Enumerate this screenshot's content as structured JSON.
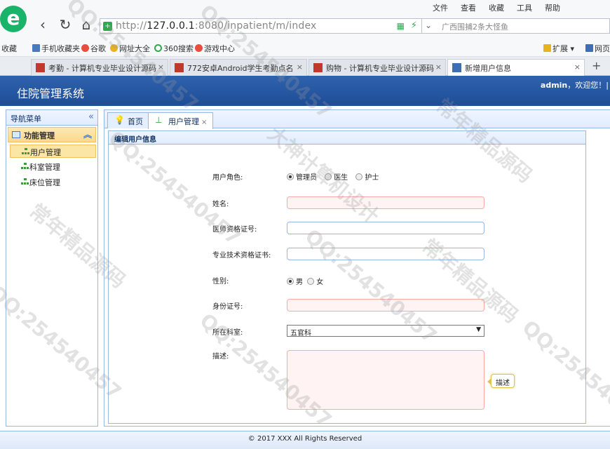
{
  "browser": {
    "menu": [
      "文件",
      "查看",
      "收藏",
      "工具",
      "帮助"
    ],
    "url_scheme": "http://",
    "url_host": "127.0.0.1",
    "url_path": ":8080/inpatient/m/index",
    "search_text": "广西围捕2条大怪鱼",
    "bookmarks": [
      "收藏",
      "手机收藏夹",
      "谷歌",
      "网址大全",
      "360搜索",
      "游戏中心",
      "扩展",
      "网页"
    ],
    "tabs": [
      {
        "label": "考勤 - 计算机专业毕业设计源码"
      },
      {
        "label": "772安卓Android学生考勤点名"
      },
      {
        "label": "购物 - 计算机专业毕业设计源码"
      },
      {
        "label": "新增用户信息"
      }
    ]
  },
  "app": {
    "title": "住院管理系统",
    "user": "admin",
    "welcome": "，欢迎您！|",
    "footer": "© 2017 XXX All Rights Reserved"
  },
  "sidebar": {
    "title": "导航菜单",
    "group": "功能管理",
    "items": [
      {
        "label": "用户管理"
      },
      {
        "label": "科室管理"
      },
      {
        "label": "床位管理"
      }
    ]
  },
  "main": {
    "tabs": [
      {
        "label": "首页"
      },
      {
        "label": "用户管理"
      }
    ],
    "panel_title": "编辑用户信息"
  },
  "form": {
    "role_label": "用户角色:",
    "roles": [
      "管理员",
      "医生",
      "护士"
    ],
    "role_selected": "管理员",
    "name_label": "姓名:",
    "doctor_cert_label": "医师资格证号:",
    "tech_cert_label": "专业技术资格证书:",
    "gender_label": "性别:",
    "genders": [
      "男",
      "女"
    ],
    "gender_selected": "男",
    "idcard_label": "身份证号:",
    "dept_label": "所在科室:",
    "dept_value": "五官科",
    "desc_label": "描述:",
    "desc_tip": "描述"
  },
  "watermarks": [
    "QQ:254540457",
    "大神计算机设计",
    "常年精品源码"
  ]
}
